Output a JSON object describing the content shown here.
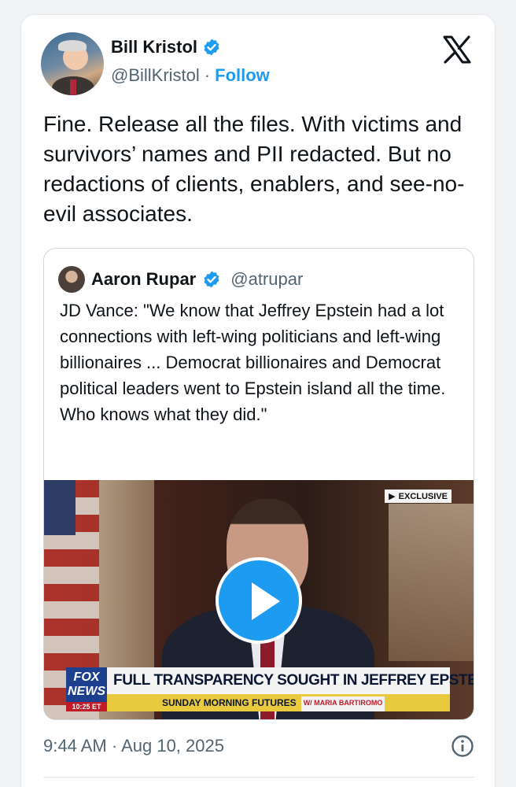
{
  "author": {
    "name": "Bill Kristol",
    "handle": "@BillKristol",
    "separator": "·",
    "follow_label": "Follow"
  },
  "tweet": {
    "text": "Fine. Release all the files. With victims and survivors’ names and PII redacted. But no redactions of clients, enablers, and see-no-evil associates.",
    "time": "9:44 AM",
    "separator": "·",
    "date": "Aug 10, 2025"
  },
  "quote": {
    "name": "Aaron Rupar",
    "handle": "@atrupar",
    "text": "JD Vance: \"We know that Jeffrey Epstein had a lot connections with left-wing politicians and left-wing billionaires ... Democrat billionaires and Democrat political leaders went to Epstein island all the time. Who knows what they did.\"",
    "video": {
      "badge": "EXCLUSIVE",
      "network": "FOX NEWS",
      "clock": "10:25 ET",
      "headline": "FULL TRANSPARENCY SOUGHT IN JEFFREY EPSTEIN CASE",
      "show": "SUNDAY MORNING FUTURES",
      "host": "W/ MARIA BARTIROMO"
    }
  },
  "colors": {
    "accent": "#1d9bf0",
    "secondary_text": "#536471",
    "primary_text": "#0f1419"
  },
  "icons": {
    "verified": "verified-badge-icon",
    "brand": "x-logo-icon",
    "play": "play-icon",
    "info": "info-icon"
  }
}
